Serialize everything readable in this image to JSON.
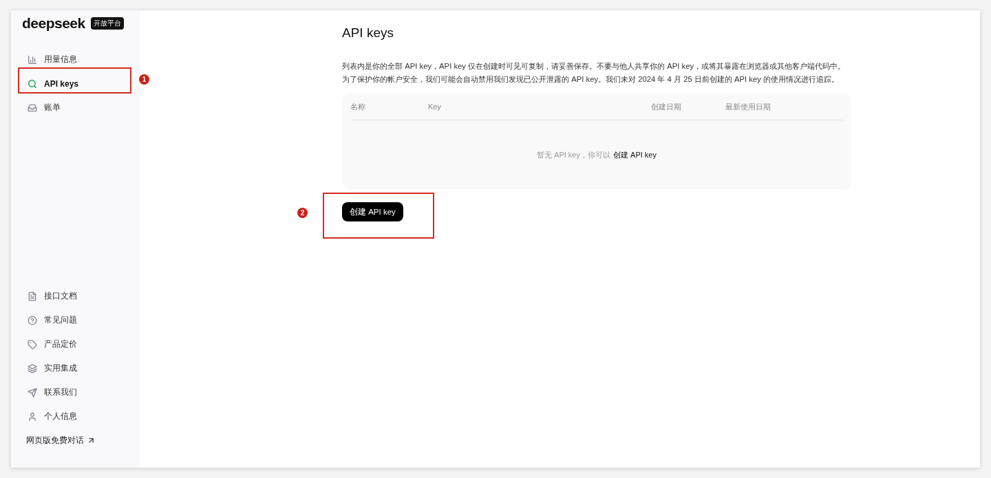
{
  "sidebar": {
    "logo": "deepseek",
    "badge": "开放平台",
    "top_items": [
      {
        "label": "用量信息",
        "selected": false
      },
      {
        "label": "API keys",
        "selected": true
      },
      {
        "label": "账单",
        "selected": false
      }
    ],
    "bottom_items": [
      {
        "label": "接口文档"
      },
      {
        "label": "常见问题"
      },
      {
        "label": "产品定价"
      },
      {
        "label": "实用集成"
      },
      {
        "label": "联系我们"
      },
      {
        "label": "个人信息"
      }
    ],
    "web_link": "网页版免费对话"
  },
  "main": {
    "title": "API keys",
    "description": [
      "列表内是你的全部 API key，API key 仅在创建时可见可复制，请妥善保存。不要与他人共享你的 API key，或将其暴露在浏览器或其他客户端代码中。",
      "为了保护你的帐户安全，我们可能会自动禁用我们发现已公开泄露的 API key。我们未对 2024 年 4 月 25 日前创建的 API key 的使用情况进行追踪。"
    ],
    "table": {
      "columns": [
        "名称",
        "Key",
        "创建日期",
        "最新使用日期"
      ],
      "empty_text": "暂无 API key，你可以",
      "empty_link": "创建 API key"
    },
    "create_button": "创建 API key"
  },
  "annotations": [
    {
      "number": "1"
    },
    {
      "number": "2"
    }
  ]
}
